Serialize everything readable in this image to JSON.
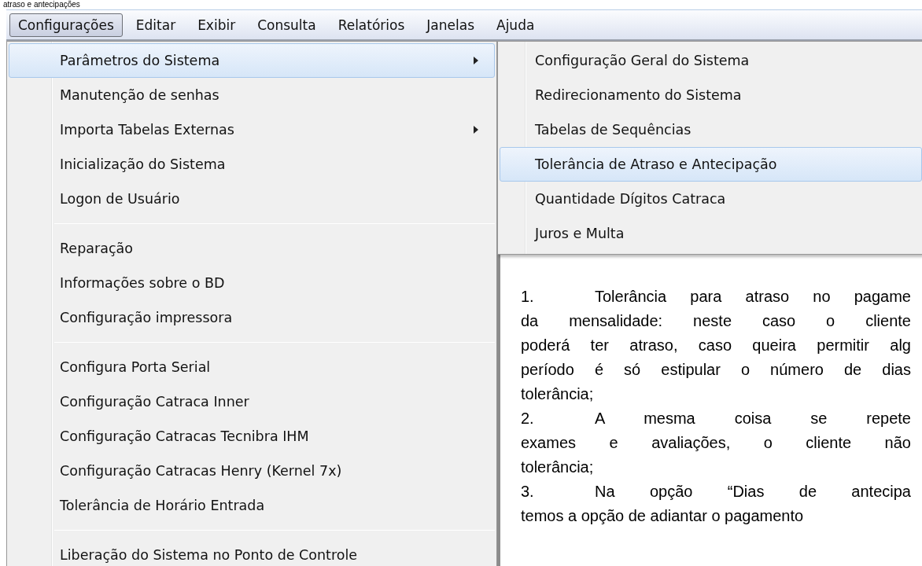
{
  "top_text": "atraso e antecipações",
  "menu_bar": [
    {
      "label": "Configurações",
      "selected": true
    },
    {
      "label": "Editar",
      "selected": false
    },
    {
      "label": "Exibir",
      "selected": false
    },
    {
      "label": "Consulta",
      "selected": false
    },
    {
      "label": "Relatórios",
      "selected": false
    },
    {
      "label": "Janelas",
      "selected": false
    },
    {
      "label": "Ajuda",
      "selected": false
    }
  ],
  "dropdown": [
    {
      "kind": "item",
      "label": "Parâmetros do Sistema",
      "selected": true,
      "has_submenu": true
    },
    {
      "kind": "item",
      "label": "Manutenção de senhas",
      "selected": false,
      "has_submenu": false
    },
    {
      "kind": "item",
      "label": "Importa Tabelas Externas",
      "selected": false,
      "has_submenu": true
    },
    {
      "kind": "item",
      "label": "Inicialização do Sistema",
      "selected": false,
      "has_submenu": false
    },
    {
      "kind": "item",
      "label": "Logon de Usuário",
      "selected": false,
      "has_submenu": false
    },
    {
      "kind": "separator"
    },
    {
      "kind": "item",
      "label": "Reparação",
      "selected": false,
      "has_submenu": false
    },
    {
      "kind": "item",
      "label": "Informações sobre o BD",
      "selected": false,
      "has_submenu": false
    },
    {
      "kind": "item",
      "label": "Configuração impressora",
      "selected": false,
      "has_submenu": false
    },
    {
      "kind": "separator"
    },
    {
      "kind": "item",
      "label": "Configura Porta Serial",
      "selected": false,
      "has_submenu": false
    },
    {
      "kind": "item",
      "label": "Configuração Catraca Inner",
      "selected": false,
      "has_submenu": false
    },
    {
      "kind": "item",
      "label": "Configuração Catracas Tecnibra IHM",
      "selected": false,
      "has_submenu": false
    },
    {
      "kind": "item",
      "label": "Configuração Catracas Henry (Kernel 7x)",
      "selected": false,
      "has_submenu": false
    },
    {
      "kind": "item",
      "label": "Tolerância de Horário Entrada",
      "selected": false,
      "has_submenu": false
    },
    {
      "kind": "separator"
    },
    {
      "kind": "item",
      "label": "Liberação do Sistema no Ponto de Controle",
      "selected": false,
      "has_submenu": false
    }
  ],
  "submenu": [
    {
      "label": "Configuração Geral do Sistema",
      "selected": false
    },
    {
      "label": "Redirecionamento do Sistema",
      "selected": false
    },
    {
      "label": "Tabelas de Sequências",
      "selected": false
    },
    {
      "label": "Tolerância de Atraso e Antecipação",
      "selected": true
    },
    {
      "label": "Quantidade Dígitos Catraca",
      "selected": false
    },
    {
      "label": "Juros e Multa",
      "selected": false
    }
  ],
  "document": [
    {
      "number": "1.",
      "text": "Tolerância para atraso no pagame",
      "justify": true
    },
    {
      "text": "da mensalidade: neste caso o cliente",
      "justify": true
    },
    {
      "text": "poderá ter atraso, caso queira permitir alg",
      "justify": true
    },
    {
      "text": "período é só estipular o número de dias",
      "justify": true
    },
    {
      "text": "tolerância;",
      "justify": false
    },
    {
      "number": "2.",
      "text": "A mesma coisa se repete",
      "justify": true
    },
    {
      "text": "exames e avaliações, o cliente não",
      "justify": true
    },
    {
      "text": "tolerância;",
      "justify": false
    },
    {
      "number": "3.",
      "text": "Na opção “Dias de antecipa",
      "justify": true
    },
    {
      "text": "temos a opção de adiantar o pagamento",
      "justify": false
    }
  ]
}
